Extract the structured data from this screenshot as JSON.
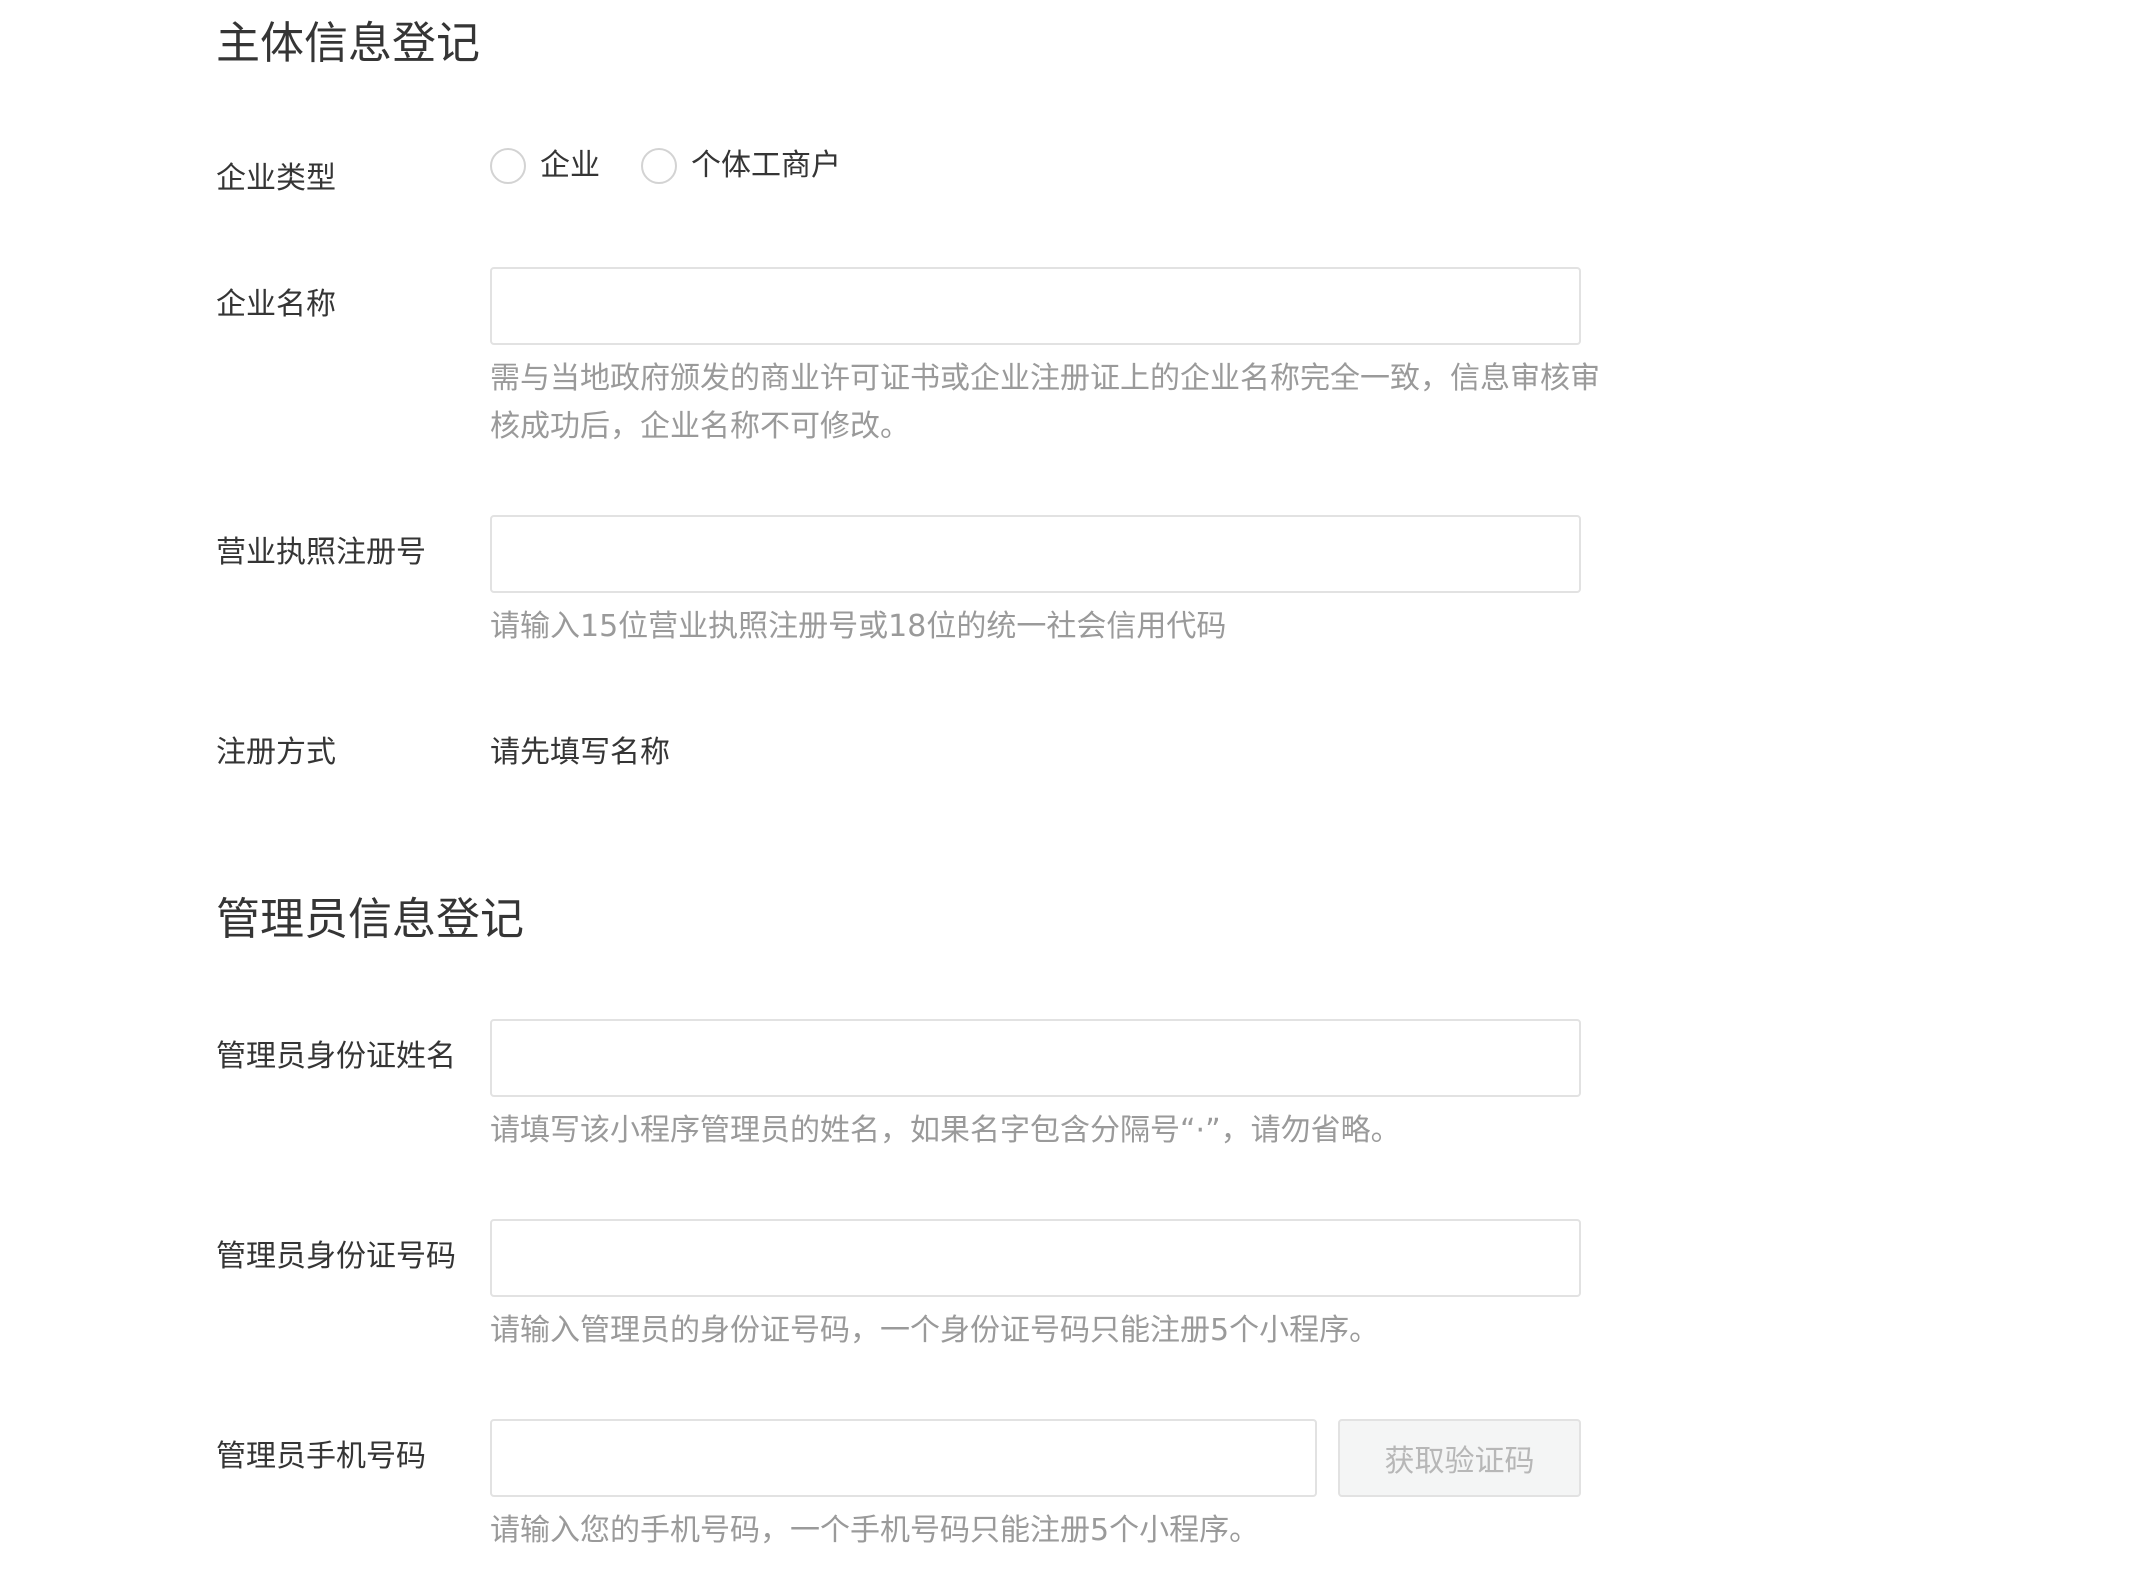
{
  "entity_section": {
    "title": "主体信息登记",
    "company_type": {
      "label": "企业类型",
      "options": [
        {
          "label": "企业",
          "selected": false
        },
        {
          "label": "个体工商户",
          "selected": false
        }
      ]
    },
    "company_name": {
      "label": "企业名称",
      "value": "",
      "hint": "需与当地政府颁发的商业许可证书或企业注册证上的企业名称完全一致，信息审核审核成功后，企业名称不可修改。"
    },
    "license_number": {
      "label": "营业执照注册号",
      "value": "",
      "hint": "请输入15位营业执照注册号或18位的统一社会信用代码"
    },
    "registration_method": {
      "label": "注册方式",
      "value": "请先填写名称"
    }
  },
  "admin_section": {
    "title": "管理员信息登记",
    "id_name": {
      "label": "管理员身份证姓名",
      "value": "",
      "hint": "请填写该小程序管理员的姓名，如果名字包含分隔号“·”，请勿省略。"
    },
    "id_number": {
      "label": "管理员身份证号码",
      "value": "",
      "hint": "请输入管理员的身份证号码，一个身份证号码只能注册5个小程序。"
    },
    "phone": {
      "label": "管理员手机号码",
      "value": "",
      "button_label": "获取验证码",
      "hint": "请输入您的手机号码，一个手机号码只能注册5个小程序。"
    }
  }
}
